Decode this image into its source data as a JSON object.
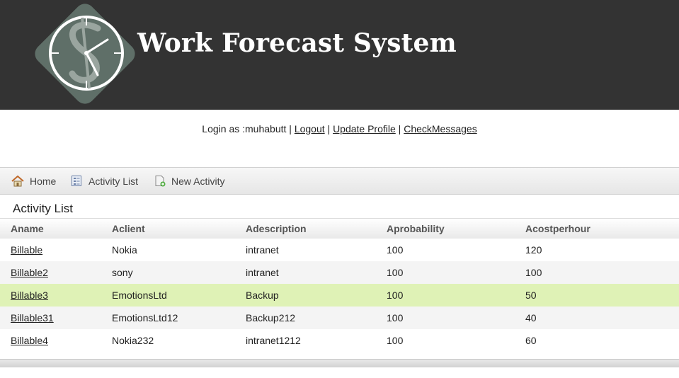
{
  "header": {
    "title": "Work Forecast System",
    "logo_icon": "clock-dollar-icon",
    "bg_color": "#333333"
  },
  "login": {
    "prefix": "Login as :muhabutt",
    "separator": "|",
    "logout": "Logout",
    "update_profile": "Update Profile",
    "check_messages": "CheckMessages"
  },
  "nav": {
    "items": [
      {
        "label": "Home",
        "icon": "home-icon"
      },
      {
        "label": "Activity List",
        "icon": "list-icon"
      },
      {
        "label": "New Activity",
        "icon": "new-document-icon"
      }
    ]
  },
  "main": {
    "section_title": "Activity List",
    "columns": [
      "Aname",
      "Aclient",
      "Adescription",
      "Aprobability",
      "Acostperhour"
    ],
    "rows": [
      [
        "Billable",
        "Nokia",
        "intranet",
        "100",
        "120"
      ],
      [
        "Billable2",
        "sony",
        "intranet",
        "100",
        "100"
      ],
      [
        "Billable3",
        "EmotionsLtd",
        "Backup",
        "100",
        "50"
      ],
      [
        "Billable31",
        "EmotionsLtd12",
        "Backup212",
        "100",
        "40"
      ],
      [
        "Billable4",
        "Nokia232",
        "intranet1212",
        "100",
        "60"
      ]
    ],
    "highlight_color": "#dff2b6"
  }
}
